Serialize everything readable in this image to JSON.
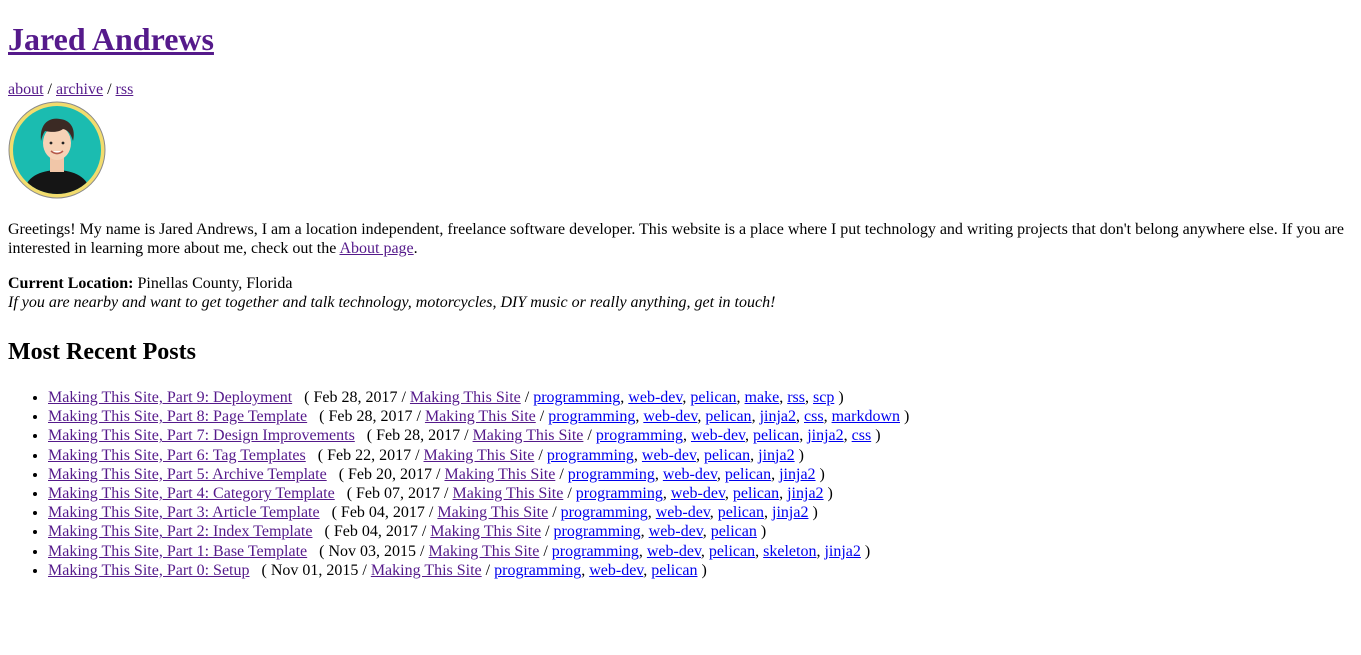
{
  "site": {
    "title": "Jared Andrews",
    "nav": [
      {
        "label": "about"
      },
      {
        "label": "archive"
      },
      {
        "label": "rss"
      }
    ],
    "nav_separator": " / "
  },
  "intro": {
    "text": "Greetings! My name is Jared Andrews, I am a location independent, freelance software developer. This website is a place where I put technology and writing projects that don't belong anywhere else. If you are interested in learning more about me, check out the ",
    "link_label": "About page",
    "suffix": "."
  },
  "location": {
    "label": "Current Location:",
    "value": "Pinellas County, Florida",
    "note": "If you are nearby and want to get together and talk technology, motorcycles, DIY music or really anything, get in touch!"
  },
  "recent_posts": {
    "heading": "Most Recent Posts",
    "posts": [
      {
        "title": "Making This Site, Part 9: Deployment",
        "date": "Feb 28, 2017",
        "category": "Making This Site",
        "tags": [
          "programming",
          "web-dev",
          "pelican",
          "make",
          "rss",
          "scp"
        ]
      },
      {
        "title": "Making This Site, Part 8: Page Template",
        "date": "Feb 28, 2017",
        "category": "Making This Site",
        "tags": [
          "programming",
          "web-dev",
          "pelican",
          "jinja2",
          "css",
          "markdown"
        ]
      },
      {
        "title": "Making This Site, Part 7: Design Improvements",
        "date": "Feb 28, 2017",
        "category": "Making This Site",
        "tags": [
          "programming",
          "web-dev",
          "pelican",
          "jinja2",
          "css"
        ]
      },
      {
        "title": "Making This Site, Part 6: Tag Templates",
        "date": "Feb 22, 2017",
        "category": "Making This Site",
        "tags": [
          "programming",
          "web-dev",
          "pelican",
          "jinja2"
        ]
      },
      {
        "title": "Making This Site, Part 5: Archive Template",
        "date": "Feb 20, 2017",
        "category": "Making This Site",
        "tags": [
          "programming",
          "web-dev",
          "pelican",
          "jinja2"
        ]
      },
      {
        "title": "Making This Site, Part 4: Category Template",
        "date": "Feb 07, 2017",
        "category": "Making This Site",
        "tags": [
          "programming",
          "web-dev",
          "pelican",
          "jinja2"
        ]
      },
      {
        "title": "Making This Site, Part 3: Article Template",
        "date": "Feb 04, 2017",
        "category": "Making This Site",
        "tags": [
          "programming",
          "web-dev",
          "pelican",
          "jinja2"
        ]
      },
      {
        "title": "Making This Site, Part 2: Index Template",
        "date": "Feb 04, 2017",
        "category": "Making This Site",
        "tags": [
          "programming",
          "web-dev",
          "pelican"
        ]
      },
      {
        "title": "Making This Site, Part 1: Base Template",
        "date": "Nov 03, 2015",
        "category": "Making This Site",
        "tags": [
          "programming",
          "web-dev",
          "pelican",
          "skeleton",
          "jinja2"
        ]
      },
      {
        "title": "Making This Site, Part 0: Setup",
        "date": "Nov 01, 2015",
        "category": "Making This Site",
        "tags": [
          "programming",
          "web-dev",
          "pelican"
        ]
      }
    ]
  },
  "colors": {
    "visited_link": "#551a8b",
    "link": "#0000ee",
    "avatar_ring": "#f2dc6e",
    "avatar_bg": "#1bbcb0"
  },
  "icons": {
    "avatar": "avatar-illustration"
  }
}
